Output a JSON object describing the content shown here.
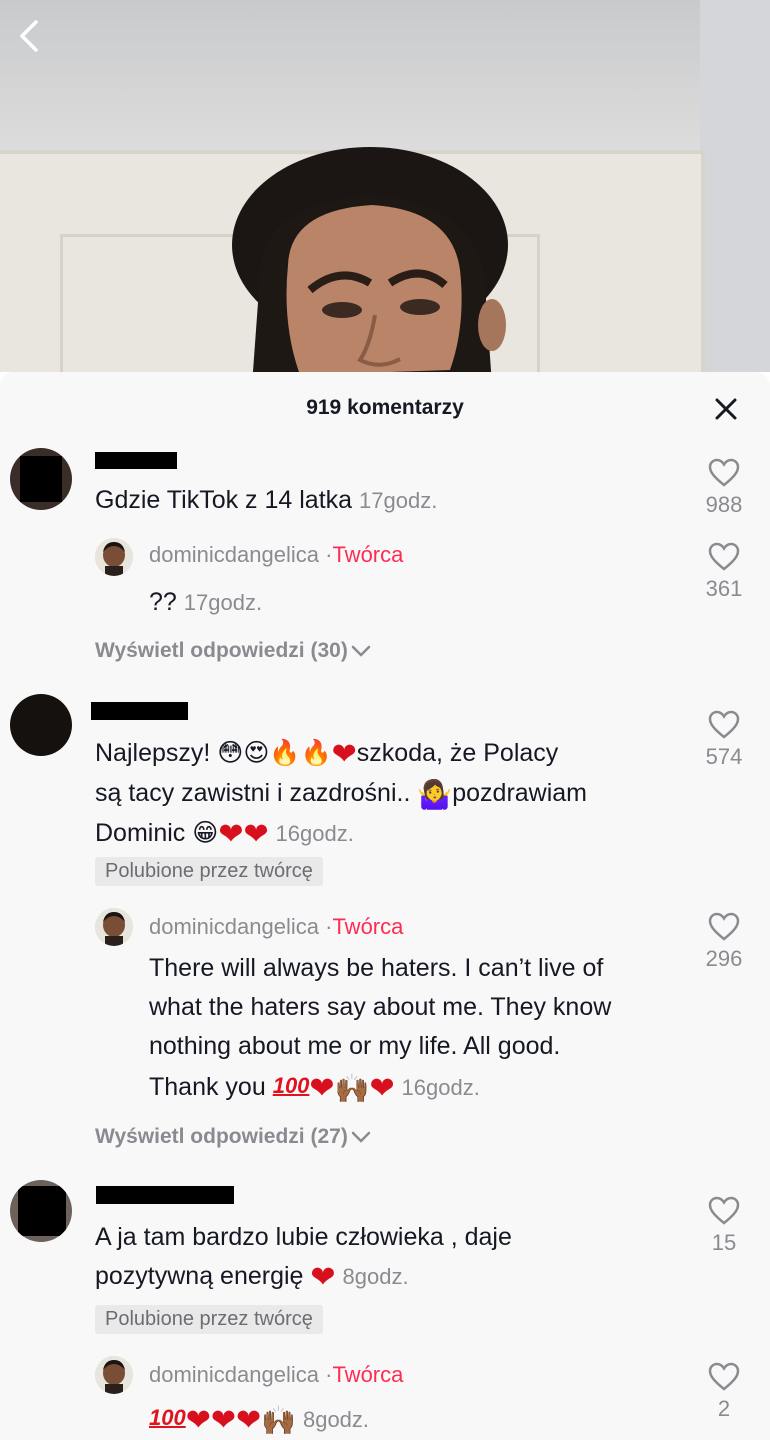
{
  "sheet": {
    "title": "919 komentarzy"
  },
  "comments": [
    {
      "text": "Gdzie TikTok z 14 latka",
      "time": "17godz.",
      "likes": "988",
      "view_replies": "Wyświetl odpowiedzi (30)",
      "reply": {
        "username": "dominicdangelica",
        "separator": "·",
        "creator_label": "Twórca",
        "text": "??",
        "time": "17godz.",
        "likes": "361"
      }
    },
    {
      "text_line1": "Najlepszy! 😳😍🔥🔥",
      "text_line1b": "szkoda, że Polacy",
      "text_line2": "są tacy zawistni i zazdrośni..",
      "text_line2b": "🤷‍♀️",
      "text_line2c": "pozdrawiam",
      "text_line3": "Dominic 😁",
      "time": "16godz.",
      "likes": "574",
      "liked_by_creator": "Polubione przez twórcę",
      "view_replies": "Wyświetl odpowiedzi (27)",
      "reply": {
        "username": "dominicdangelica",
        "separator": "·",
        "creator_label": "Twórca",
        "text_line1": "There will always be haters. I can’t live of",
        "text_line2": "what the haters say about me. They know",
        "text_line3": "nothing about me or my life. All good.",
        "text_line4": "Thank you",
        "hundred": "100",
        "raised_hands": "🙌🏾",
        "time": "16godz.",
        "likes": "296"
      }
    },
    {
      "text_line1": "A ja tam bardzo lubie człowieka , daje",
      "text_line2": "pozytywną energię",
      "time": "8godz.",
      "likes": "15",
      "liked_by_creator": "Polubione przez twórcę",
      "reply": {
        "username": "dominicdangelica",
        "separator": "·",
        "creator_label": "Twórca",
        "hundred": "100",
        "raised_hands": "🙌🏾",
        "time": "8godz.",
        "likes": "2"
      }
    }
  ],
  "icons": {
    "back": "chevron-left-icon",
    "close": "close-icon",
    "like": "heart-outline-icon",
    "heart_emoji": "red-heart-emoji",
    "expand": "chevron-down-icon"
  },
  "colors": {
    "creator": "#fe2c55",
    "muted": "#8a8b91",
    "sheet_bg": "#f8f8f8",
    "heart_emoji": "#d80f1c"
  }
}
